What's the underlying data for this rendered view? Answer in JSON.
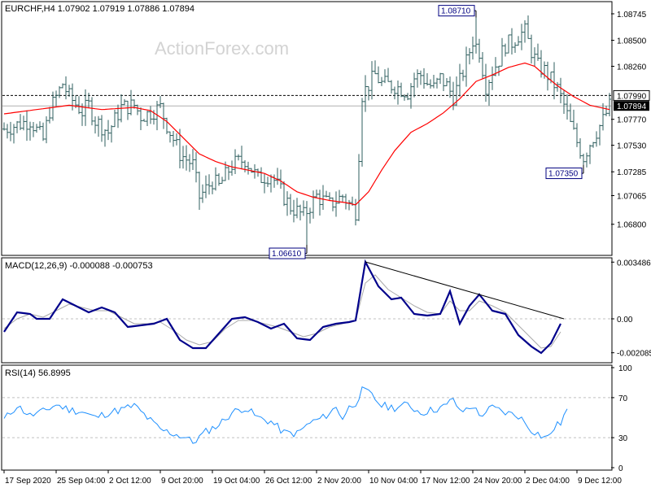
{
  "header": {
    "main_title": "EURCHF,H4  1.07902 1.07919 1.07886 1.07894",
    "watermark": "ActionForex.com",
    "macd_title": "MACD(12,26,9) -0.000088 -0.000753",
    "rsi_title": "RSI(14) 56.8995"
  },
  "colors": {
    "bars": "#2f5f5f",
    "ma": "#ff0000",
    "macd": "#00008b",
    "signal": "#a9a9a9",
    "rsi": "#1e90ff",
    "frame": "#000000",
    "watermark": "#d3d3d3"
  },
  "chart_data": [
    {
      "type": "ohlc",
      "panel": "price",
      "symbol": "EURCHF",
      "timeframe": "H4",
      "ylim": [
        1.0652,
        1.0885
      ],
      "yticks": [
        "1.06800",
        "1.07065",
        "1.07285",
        "1.07530",
        "1.07770",
        "1.08260",
        "1.08500",
        "1.08745"
      ],
      "levels": {
        "resistance": "1.07990",
        "last": "1.07894"
      },
      "annotations": [
        {
          "label": "1.08710",
          "bar": 145,
          "value": 1.0871
        },
        {
          "label": "1.07350",
          "bar": 178,
          "value": 1.0735
        },
        {
          "label": "1.06610",
          "bar": 93,
          "value": 1.0661
        }
      ],
      "close_path": [
        [
          0,
          1.0768
        ],
        [
          8,
          1.0776
        ],
        [
          12,
          1.0758
        ],
        [
          14,
          1.0785
        ],
        [
          18,
          1.081
        ],
        [
          20,
          1.0798
        ],
        [
          24,
          1.0784
        ],
        [
          26,
          1.079
        ],
        [
          28,
          1.0776
        ],
        [
          32,
          1.0765
        ],
        [
          36,
          1.0788
        ],
        [
          40,
          1.079
        ],
        [
          42,
          1.078
        ],
        [
          44,
          1.0782
        ],
        [
          48,
          1.0788
        ],
        [
          50,
          1.0772
        ],
        [
          54,
          1.0745
        ],
        [
          58,
          1.0735
        ],
        [
          60,
          1.0705
        ],
        [
          64,
          1.072
        ],
        [
          66,
          1.0715
        ],
        [
          70,
          1.0735
        ],
        [
          74,
          1.074
        ],
        [
          78,
          1.0722
        ],
        [
          82,
          1.0726
        ],
        [
          86,
          1.0705
        ],
        [
          88,
          1.0696
        ],
        [
          92,
          1.0688
        ],
        [
          96,
          1.0706
        ],
        [
          100,
          1.0698
        ],
        [
          104,
          1.0706
        ],
        [
          108,
          1.0692
        ],
        [
          110,
          1.08
        ],
        [
          114,
          1.0818
        ],
        [
          116,
          1.081
        ],
        [
          120,
          1.0808
        ],
        [
          124,
          1.0802
        ],
        [
          126,
          1.0815
        ],
        [
          128,
          1.0818
        ],
        [
          130,
          1.081
        ],
        [
          132,
          1.0806
        ],
        [
          134,
          1.0815
        ],
        [
          136,
          1.0808
        ],
        [
          138,
          1.0798
        ],
        [
          140,
          1.0812
        ],
        [
          142,
          1.083
        ],
        [
          144,
          1.085
        ],
        [
          146,
          1.084
        ],
        [
          148,
          1.0808
        ],
        [
          150,
          1.0822
        ],
        [
          152,
          1.0832
        ],
        [
          154,
          1.0846
        ],
        [
          156,
          1.0848
        ],
        [
          158,
          1.0855
        ],
        [
          160,
          1.0858
        ],
        [
          162,
          1.084
        ],
        [
          164,
          1.0826
        ],
        [
          166,
          1.0822
        ],
        [
          170,
          1.0805
        ],
        [
          172,
          1.079
        ],
        [
          174,
          1.0772
        ],
        [
          176,
          1.0756
        ],
        [
          178,
          1.0742
        ],
        [
          180,
          1.0755
        ],
        [
          182,
          1.0766
        ],
        [
          184,
          1.0776
        ],
        [
          186,
          1.0789
        ]
      ],
      "ma_path": [
        [
          0,
          1.0782
        ],
        [
          10,
          1.0786
        ],
        [
          20,
          1.079
        ],
        [
          30,
          1.0786
        ],
        [
          40,
          1.0788
        ],
        [
          45,
          1.0785
        ],
        [
          50,
          1.0775
        ],
        [
          55,
          1.076
        ],
        [
          60,
          1.0745
        ],
        [
          65,
          1.0738
        ],
        [
          70,
          1.0733
        ],
        [
          75,
          1.073
        ],
        [
          80,
          1.0727
        ],
        [
          85,
          1.072
        ],
        [
          90,
          1.071
        ],
        [
          95,
          1.0705
        ],
        [
          100,
          1.0702
        ],
        [
          105,
          1.07
        ],
        [
          108,
          1.0698
        ],
        [
          112,
          1.071
        ],
        [
          116,
          1.073
        ],
        [
          120,
          1.0748
        ],
        [
          125,
          1.0765
        ],
        [
          130,
          1.0773
        ],
        [
          135,
          1.0783
        ],
        [
          140,
          1.0796
        ],
        [
          145,
          1.0812
        ],
        [
          150,
          1.0818
        ],
        [
          155,
          1.0825
        ],
        [
          160,
          1.0829
        ],
        [
          163,
          1.0826
        ],
        [
          166,
          1.0818
        ],
        [
          170,
          1.0808
        ],
        [
          175,
          1.0798
        ],
        [
          180,
          1.079
        ],
        [
          186,
          1.0786
        ]
      ],
      "seed": 7,
      "bar_count": 187
    },
    {
      "type": "line",
      "panel": "macd",
      "name": "MACD(12,26,9)",
      "ylim": [
        -0.00265,
        0.0037
      ],
      "yticks": [
        "0.003486",
        "0.00",
        "-0.002085"
      ],
      "macd": [
        [
          0,
          -0.0008
        ],
        [
          4,
          0.0004
        ],
        [
          8,
          0.0003
        ],
        [
          10,
          0.0
        ],
        [
          14,
          0.0
        ],
        [
          18,
          0.0012
        ],
        [
          22,
          0.0008
        ],
        [
          26,
          0.0004
        ],
        [
          30,
          0.0007
        ],
        [
          34,
          0.0004
        ],
        [
          38,
          -0.0005
        ],
        [
          42,
          -0.0004
        ],
        [
          46,
          -0.0003
        ],
        [
          50,
          0.0
        ],
        [
          54,
          -0.0013
        ],
        [
          58,
          -0.0018
        ],
        [
          62,
          -0.0018
        ],
        [
          66,
          -0.0009
        ],
        [
          70,
          0.0
        ],
        [
          74,
          0.0001
        ],
        [
          78,
          -0.0002
        ],
        [
          82,
          -0.0006
        ],
        [
          86,
          -0.0003
        ],
        [
          90,
          -0.0012
        ],
        [
          94,
          -0.0013
        ],
        [
          98,
          -0.0005
        ],
        [
          102,
          -0.0003
        ],
        [
          106,
          -0.0002
        ],
        [
          108,
          -0.0001
        ],
        [
          111,
          0.0035
        ],
        [
          115,
          0.002
        ],
        [
          119,
          0.0012
        ],
        [
          122,
          0.0013
        ],
        [
          126,
          0.0003
        ],
        [
          130,
          0.0002
        ],
        [
          134,
          0.0003
        ],
        [
          137,
          0.0017
        ],
        [
          140,
          -0.0003
        ],
        [
          143,
          0.0008
        ],
        [
          146,
          0.0015
        ],
        [
          150,
          0.0005
        ],
        [
          154,
          0.0003
        ],
        [
          158,
          -0.001
        ],
        [
          162,
          -0.0017
        ],
        [
          165,
          -0.0021
        ],
        [
          168,
          -0.0015
        ],
        [
          171,
          -0.0003
        ]
      ],
      "signal": [
        [
          0,
          -0.0006
        ],
        [
          4,
          0.0
        ],
        [
          8,
          0.0003
        ],
        [
          12,
          0.0001
        ],
        [
          16,
          0.0005
        ],
        [
          20,
          0.0009
        ],
        [
          24,
          0.0007
        ],
        [
          28,
          0.0005
        ],
        [
          32,
          0.0005
        ],
        [
          36,
          0.0001
        ],
        [
          40,
          -0.0003
        ],
        [
          44,
          -0.0003
        ],
        [
          48,
          -0.0002
        ],
        [
          52,
          -0.0007
        ],
        [
          56,
          -0.0013
        ],
        [
          60,
          -0.0016
        ],
        [
          64,
          -0.0014
        ],
        [
          68,
          -0.0006
        ],
        [
          72,
          -0.0001
        ],
        [
          76,
          -0.0001
        ],
        [
          80,
          -0.0003
        ],
        [
          84,
          -0.0005
        ],
        [
          88,
          -0.0008
        ],
        [
          92,
          -0.0011
        ],
        [
          96,
          -0.0009
        ],
        [
          100,
          -0.0005
        ],
        [
          104,
          -0.0003
        ],
        [
          108,
          -0.0001
        ],
        [
          111,
          0.0022
        ],
        [
          114,
          0.0027
        ],
        [
          118,
          0.0018
        ],
        [
          122,
          0.0013
        ],
        [
          126,
          0.0008
        ],
        [
          130,
          0.0004
        ],
        [
          134,
          0.0003
        ],
        [
          137,
          0.0011
        ],
        [
          140,
          0.0005
        ],
        [
          143,
          0.0005
        ],
        [
          146,
          0.0011
        ],
        [
          150,
          0.0008
        ],
        [
          154,
          0.0004
        ],
        [
          158,
          -0.0004
        ],
        [
          162,
          -0.0012
        ],
        [
          165,
          -0.0018
        ],
        [
          168,
          -0.0017
        ],
        [
          171,
          -0.0008
        ]
      ],
      "trendline": [
        [
          111,
          0.0035
        ],
        [
          172,
          0.0
        ]
      ]
    },
    {
      "type": "line",
      "panel": "rsi",
      "name": "RSI(14)",
      "ylim": [
        0,
        100
      ],
      "yticks": [
        100,
        70,
        30,
        0
      ],
      "levels": [
        70,
        30
      ],
      "rsi": [
        [
          0,
          48
        ],
        [
          4,
          62
        ],
        [
          8,
          52
        ],
        [
          12,
          56
        ],
        [
          16,
          63
        ],
        [
          20,
          58
        ],
        [
          24,
          56
        ],
        [
          28,
          50
        ],
        [
          32,
          55
        ],
        [
          36,
          58
        ],
        [
          40,
          62
        ],
        [
          44,
          50
        ],
        [
          48,
          38
        ],
        [
          52,
          34
        ],
        [
          56,
          30
        ],
        [
          58,
          25
        ],
        [
          62,
          36
        ],
        [
          66,
          43
        ],
        [
          70,
          55
        ],
        [
          74,
          60
        ],
        [
          78,
          50
        ],
        [
          82,
          46
        ],
        [
          86,
          35
        ],
        [
          90,
          34
        ],
        [
          94,
          45
        ],
        [
          98,
          50
        ],
        [
          102,
          60
        ],
        [
          104,
          50
        ],
        [
          106,
          60
        ],
        [
          108,
          65
        ],
        [
          110,
          77
        ],
        [
          112,
          75
        ],
        [
          116,
          62
        ],
        [
          120,
          60
        ],
        [
          124,
          63
        ],
        [
          128,
          55
        ],
        [
          132,
          58
        ],
        [
          136,
          62
        ],
        [
          138,
          70
        ],
        [
          140,
          55
        ],
        [
          144,
          62
        ],
        [
          146,
          52
        ],
        [
          150,
          60
        ],
        [
          154,
          55
        ],
        [
          158,
          52
        ],
        [
          162,
          38
        ],
        [
          165,
          32
        ],
        [
          167,
          30
        ],
        [
          169,
          40
        ],
        [
          171,
          45
        ],
        [
          173,
          58
        ]
      ]
    }
  ],
  "x_axis": {
    "bar_count": 187,
    "labels": [
      {
        "bar": 0,
        "label": "17 Sep 2020"
      },
      {
        "bar": 16,
        "label": "25 Sep 04:00"
      },
      {
        "bar": 32,
        "label": "2 Oct 12:00"
      },
      {
        "bar": 48,
        "label": "9 Oct 20:00"
      },
      {
        "bar": 64,
        "label": "19 Oct 04:00"
      },
      {
        "bar": 80,
        "label": "26 Oct 12:00"
      },
      {
        "bar": 96,
        "label": "2 Nov 20:00"
      },
      {
        "bar": 112,
        "label": "10 Nov 04:00"
      },
      {
        "bar": 128,
        "label": "17 Nov 12:00"
      },
      {
        "bar": 144,
        "label": "24 Nov 20:00"
      },
      {
        "bar": 160,
        "label": "2 Dec 04:00"
      },
      {
        "bar": 176,
        "label": "9 Dec 12:00"
      }
    ]
  }
}
